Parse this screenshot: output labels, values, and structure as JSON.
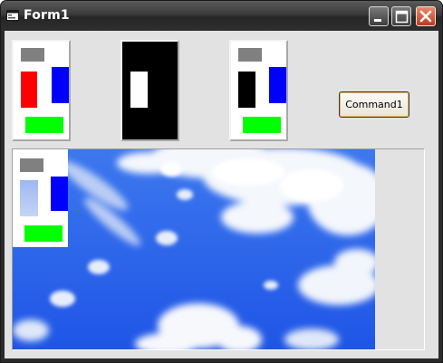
{
  "window": {
    "title": "Form1",
    "controls": [
      "minimize-icon",
      "maximize-icon",
      "close-icon"
    ]
  },
  "command_button": {
    "label": "Command1"
  },
  "colors": {
    "gray_block": "#808080",
    "red_block": "#ff0000",
    "blue_block": "#0000ff",
    "green_block": "#00ff00",
    "black_block": "#000000",
    "white_block": "#ffffff",
    "faded_block": "#a9c3f5",
    "sky": "#2f6af0"
  }
}
